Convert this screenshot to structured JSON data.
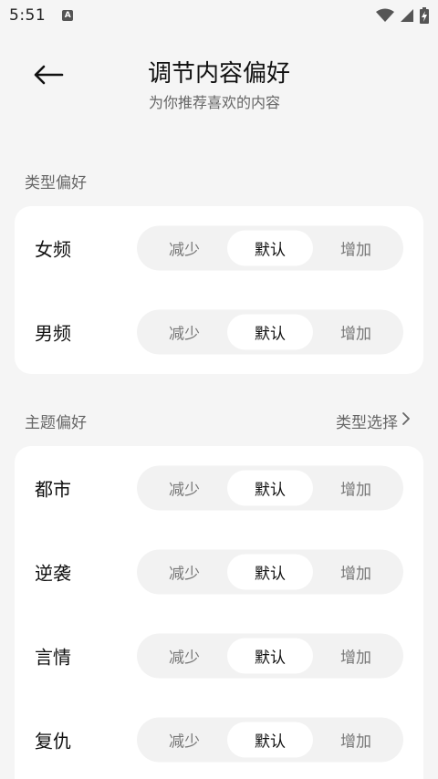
{
  "status_bar": {
    "time": "5:51",
    "notification_letter": "A"
  },
  "header": {
    "title": "调节内容偏好",
    "subtitle": "为你推荐喜欢的内容"
  },
  "sections": {
    "type_pref": {
      "title": "类型偏好",
      "rows": [
        {
          "label": "女频",
          "options": [
            "减少",
            "默认",
            "增加"
          ],
          "selected": "默认"
        },
        {
          "label": "男频",
          "options": [
            "减少",
            "默认",
            "增加"
          ],
          "selected": "默认"
        }
      ]
    },
    "theme_pref": {
      "title": "主题偏好",
      "link": "类型选择",
      "rows": [
        {
          "label": "都市",
          "options": [
            "减少",
            "默认",
            "增加"
          ],
          "selected": "默认"
        },
        {
          "label": "逆袭",
          "options": [
            "减少",
            "默认",
            "增加"
          ],
          "selected": "默认"
        },
        {
          "label": "言情",
          "options": [
            "减少",
            "默认",
            "增加"
          ],
          "selected": "默认"
        },
        {
          "label": "复仇",
          "options": [
            "减少",
            "默认",
            "增加"
          ],
          "selected": "默认"
        }
      ]
    }
  }
}
